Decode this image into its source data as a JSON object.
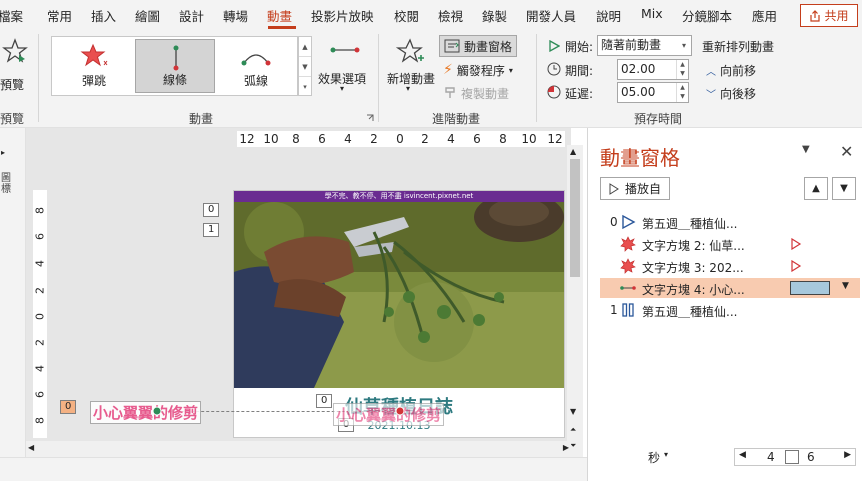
{
  "tabs": [
    {
      "label": "檔案",
      "active": false
    },
    {
      "label": "常用",
      "active": false
    },
    {
      "label": "插入",
      "active": false
    },
    {
      "label": "繪圖",
      "active": false
    },
    {
      "label": "設計",
      "active": false
    },
    {
      "label": "轉場",
      "active": false
    },
    {
      "label": "動畫",
      "active": true
    },
    {
      "label": "投影片放映",
      "active": false
    },
    {
      "label": "校閱",
      "active": false
    },
    {
      "label": "檢視",
      "active": false
    },
    {
      "label": "錄製",
      "active": false
    },
    {
      "label": "開發人員",
      "active": false
    },
    {
      "label": "說明",
      "active": false
    },
    {
      "label": "Mix",
      "active": false
    },
    {
      "label": "分鏡腳本",
      "active": false
    },
    {
      "label": "應用",
      "active": false
    }
  ],
  "share_label": "共用",
  "ribbon": {
    "preview": {
      "button_label": "預覽",
      "group_label": "預覽"
    },
    "animation": {
      "group_label": "動畫",
      "gallery": [
        {
          "label": "彈跳",
          "selected": false
        },
        {
          "label": "線條",
          "selected": true
        },
        {
          "label": "弧線",
          "selected": false
        }
      ],
      "effect_options_label": "效果選項"
    },
    "advanced": {
      "group_label": "進階動畫",
      "add_animation_label": "新增動畫",
      "animation_pane_label": "動畫窗格",
      "trigger_label": "觸發程序",
      "painter_label": "複製動畫"
    },
    "timing": {
      "group_label": "預存時間",
      "start_label": "開始:",
      "start_value": "隨著前動畫",
      "duration_label": "期間:",
      "duration_value": "02.00",
      "delay_label": "延遲:",
      "delay_value": "05.00",
      "reorder_label": "重新排列動畫",
      "move_earlier_label": "向前移",
      "move_later_label": "向後移"
    }
  },
  "left_strip_label": "圖標",
  "ruler": {
    "h_ticks": [
      "12",
      "10",
      "8",
      "6",
      "4",
      "2",
      "0",
      "2",
      "4",
      "6",
      "8",
      "10",
      "12"
    ],
    "v_ticks": [
      "8",
      "6",
      "4",
      "2",
      "0",
      "2",
      "4",
      "6",
      "8"
    ]
  },
  "slide": {
    "banner": "學不完、教不停、用不盡 isvincent.pixnet.net",
    "title": "仙草種植日誌",
    "date": "2021.10.13",
    "caution_text": "小心翼翼的修剪",
    "tags": {
      "t0_top": "0",
      "t1": "1",
      "t0_left": "0",
      "t0_mid": "0",
      "t0_bottom": "0"
    }
  },
  "pane": {
    "title": "動畫窗格",
    "play_label": "播放自",
    "items": [
      {
        "num": "0",
        "label": "第五週＿種植仙...",
        "icon": "play-trigger-icon",
        "selected": false
      },
      {
        "num": "",
        "label": "文字方塊 2: 仙草...",
        "icon": "starburst-icon",
        "selected": false
      },
      {
        "num": "",
        "label": "文字方塊 3: 202...",
        "icon": "starburst-icon",
        "selected": false
      },
      {
        "num": "",
        "label": "文字方塊 4: 小心...",
        "icon": "line-path-icon",
        "selected": true
      },
      {
        "num": "1",
        "label": "第五週＿種植仙...",
        "icon": "pause-icon",
        "selected": false
      }
    ],
    "footer": {
      "seconds_label": "秒",
      "range_start": "4",
      "range_end": "6"
    }
  }
}
